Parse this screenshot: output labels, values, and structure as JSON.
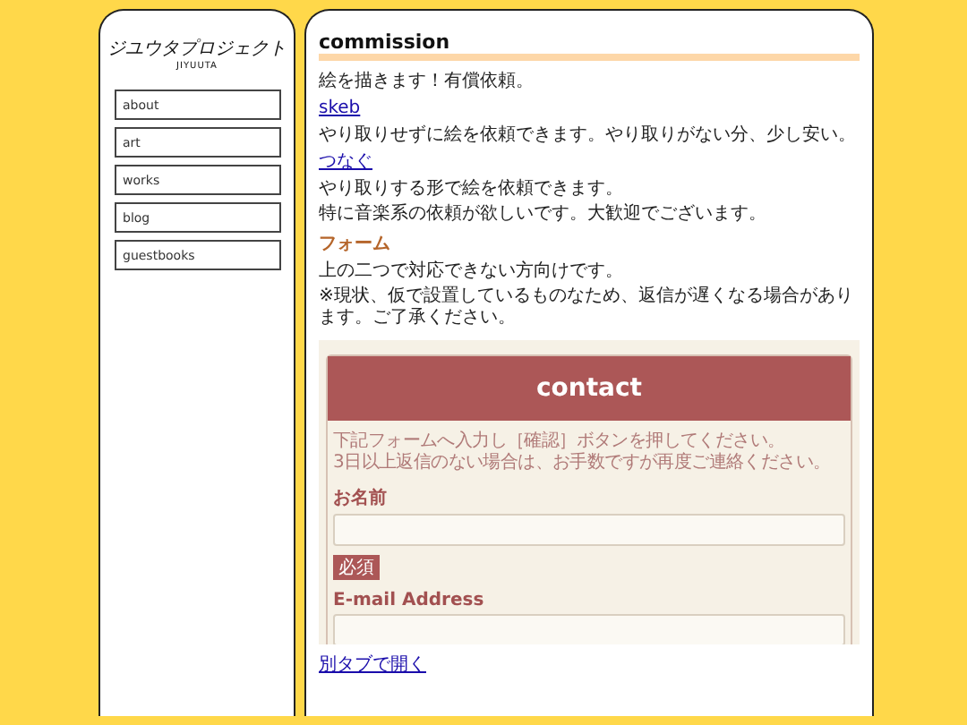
{
  "sidebar": {
    "logo": "ジユウタプロジェクト",
    "logo_sub": "JIYUUTA",
    "nav": [
      {
        "label": "about"
      },
      {
        "label": "art"
      },
      {
        "label": "works"
      },
      {
        "label": "blog"
      },
      {
        "label": "guestbooks"
      }
    ]
  },
  "main": {
    "title": "commission",
    "blocks": [
      {
        "kind": "text",
        "text": "絵を描きます！有償依頼。"
      },
      {
        "kind": "link",
        "text": "skeb"
      },
      {
        "kind": "text",
        "text": "やり取りせずに絵を依頼できます。やり取りがない分、少し安い。"
      },
      {
        "kind": "link",
        "text": "つなぐ"
      },
      {
        "kind": "text",
        "text": "やり取りする形で絵を依頼できます。"
      },
      {
        "kind": "text",
        "text": "特に音楽系の依頼が欲しいです。大歓迎でございます。"
      },
      {
        "kind": "heading",
        "text": "フォーム"
      },
      {
        "kind": "text",
        "text": "上の二つで対応できない方向けです。"
      },
      {
        "kind": "text",
        "text": "※現状、仮で設置しているものなため、返信が遅くなる場合があります。ご了承ください。"
      }
    ],
    "form": {
      "title": "contact",
      "intro": [
        "下記フォームへ入力し［確認］ボタンを押してください。",
        "3日以上返信のない場合は、お手数ですが再度ご連絡ください。"
      ],
      "fields": [
        {
          "label": "お名前",
          "required": true,
          "badge": "必須"
        },
        {
          "label": "E-mail Address"
        }
      ]
    },
    "open_link": "別タブで開く"
  }
}
